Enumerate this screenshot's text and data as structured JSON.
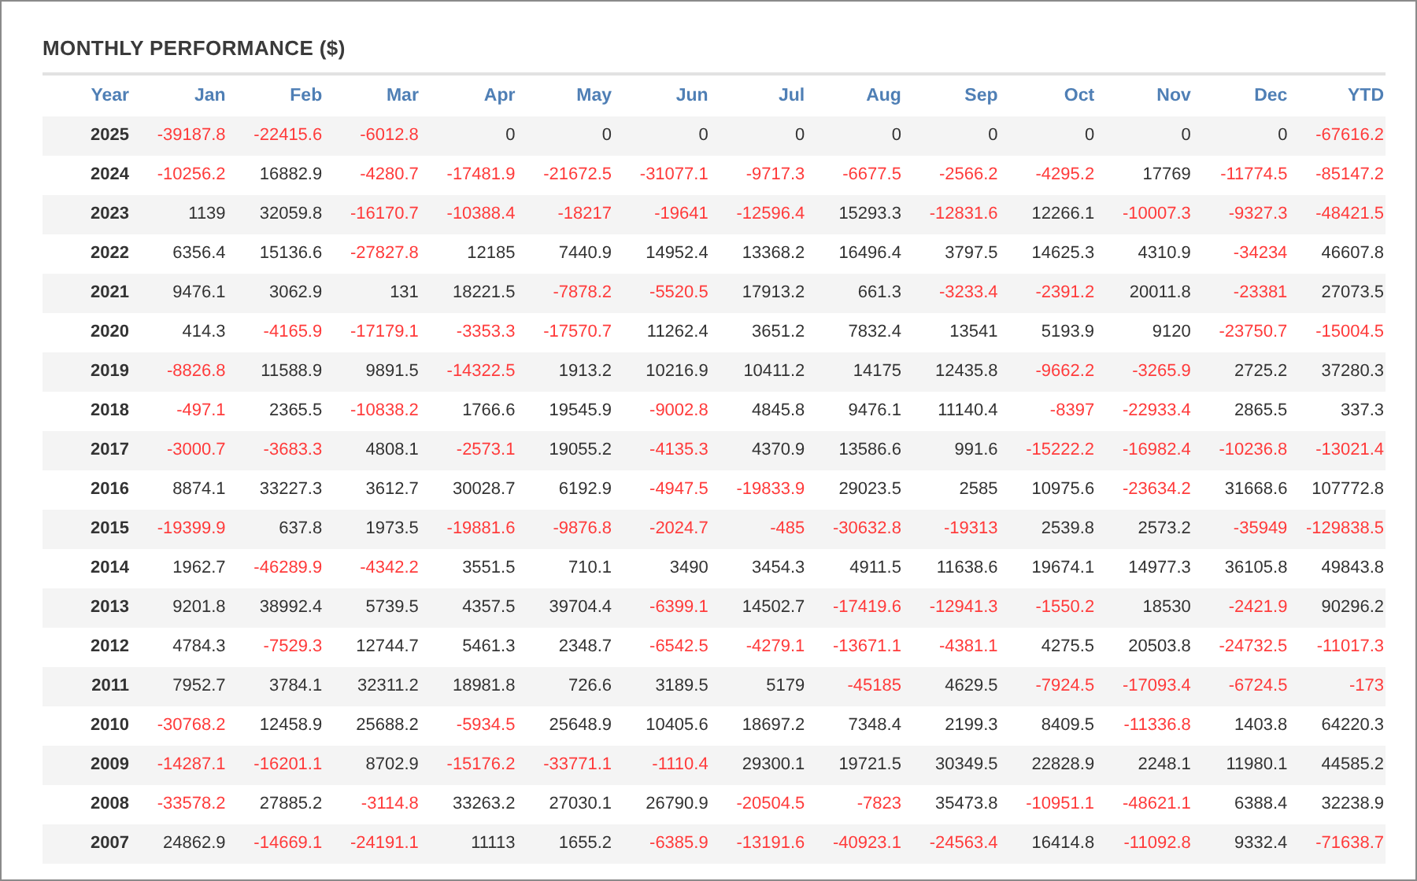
{
  "title": "MONTHLY PERFORMANCE ($)",
  "columns": [
    "Year",
    "Jan",
    "Feb",
    "Mar",
    "Apr",
    "May",
    "Jun",
    "Jul",
    "Aug",
    "Sep",
    "Oct",
    "Nov",
    "Dec",
    "YTD"
  ],
  "rows": [
    {
      "year": "2025",
      "cells": [
        {
          "text": "-39187.8",
          "negative": true
        },
        {
          "text": "-22415.6",
          "negative": true
        },
        {
          "text": "-6012.8",
          "negative": true
        },
        {
          "text": "0",
          "negative": false
        },
        {
          "text": "0",
          "negative": false
        },
        {
          "text": "0",
          "negative": false
        },
        {
          "text": "0",
          "negative": false
        },
        {
          "text": "0",
          "negative": false
        },
        {
          "text": "0",
          "negative": false
        },
        {
          "text": "0",
          "negative": false
        },
        {
          "text": "0",
          "negative": false
        },
        {
          "text": "0",
          "negative": false
        },
        {
          "text": "-67616.2",
          "negative": true
        }
      ]
    },
    {
      "year": "2024",
      "cells": [
        {
          "text": "-10256.2",
          "negative": true
        },
        {
          "text": "16882.9",
          "negative": false
        },
        {
          "text": "-4280.7",
          "negative": true
        },
        {
          "text": "-17481.9",
          "negative": true
        },
        {
          "text": "-21672.5",
          "negative": true
        },
        {
          "text": "-31077.1",
          "negative": true
        },
        {
          "text": "-9717.3",
          "negative": true
        },
        {
          "text": "-6677.5",
          "negative": true
        },
        {
          "text": "-2566.2",
          "negative": true
        },
        {
          "text": "-4295.2",
          "negative": true
        },
        {
          "text": "17769",
          "negative": false
        },
        {
          "text": "-11774.5",
          "negative": true
        },
        {
          "text": "-85147.2",
          "negative": true
        }
      ]
    },
    {
      "year": "2023",
      "cells": [
        {
          "text": "1139",
          "negative": false
        },
        {
          "text": "32059.8",
          "negative": false
        },
        {
          "text": "-16170.7",
          "negative": true
        },
        {
          "text": "-10388.4",
          "negative": true
        },
        {
          "text": "-18217",
          "negative": true
        },
        {
          "text": "-19641",
          "negative": true
        },
        {
          "text": "-12596.4",
          "negative": true
        },
        {
          "text": "15293.3",
          "negative": false
        },
        {
          "text": "-12831.6",
          "negative": true
        },
        {
          "text": "12266.1",
          "negative": false
        },
        {
          "text": "-10007.3",
          "negative": true
        },
        {
          "text": "-9327.3",
          "negative": true
        },
        {
          "text": "-48421.5",
          "negative": true
        }
      ]
    },
    {
      "year": "2022",
      "cells": [
        {
          "text": "6356.4",
          "negative": false
        },
        {
          "text": "15136.6",
          "negative": false
        },
        {
          "text": "-27827.8",
          "negative": true
        },
        {
          "text": "12185",
          "negative": false
        },
        {
          "text": "7440.9",
          "negative": false
        },
        {
          "text": "14952.4",
          "negative": false
        },
        {
          "text": "13368.2",
          "negative": false
        },
        {
          "text": "16496.4",
          "negative": false
        },
        {
          "text": "3797.5",
          "negative": false
        },
        {
          "text": "14625.3",
          "negative": false
        },
        {
          "text": "4310.9",
          "negative": false
        },
        {
          "text": "-34234",
          "negative": true
        },
        {
          "text": "46607.8",
          "negative": false
        }
      ]
    },
    {
      "year": "2021",
      "cells": [
        {
          "text": "9476.1",
          "negative": false
        },
        {
          "text": "3062.9",
          "negative": false
        },
        {
          "text": "131",
          "negative": false
        },
        {
          "text": "18221.5",
          "negative": false
        },
        {
          "text": "-7878.2",
          "negative": true
        },
        {
          "text": "-5520.5",
          "negative": true
        },
        {
          "text": "17913.2",
          "negative": false
        },
        {
          "text": "661.3",
          "negative": false
        },
        {
          "text": "-3233.4",
          "negative": true
        },
        {
          "text": "-2391.2",
          "negative": true
        },
        {
          "text": "20011.8",
          "negative": false
        },
        {
          "text": "-23381",
          "negative": true
        },
        {
          "text": "27073.5",
          "negative": false
        }
      ]
    },
    {
      "year": "2020",
      "cells": [
        {
          "text": "414.3",
          "negative": false
        },
        {
          "text": "-4165.9",
          "negative": true
        },
        {
          "text": "-17179.1",
          "negative": true
        },
        {
          "text": "-3353.3",
          "negative": true
        },
        {
          "text": "-17570.7",
          "negative": true
        },
        {
          "text": "11262.4",
          "negative": false
        },
        {
          "text": "3651.2",
          "negative": false
        },
        {
          "text": "7832.4",
          "negative": false
        },
        {
          "text": "13541",
          "negative": false
        },
        {
          "text": "5193.9",
          "negative": false
        },
        {
          "text": "9120",
          "negative": false
        },
        {
          "text": "-23750.7",
          "negative": true
        },
        {
          "text": "-15004.5",
          "negative": true
        }
      ]
    },
    {
      "year": "2019",
      "cells": [
        {
          "text": "-8826.8",
          "negative": true
        },
        {
          "text": "11588.9",
          "negative": false
        },
        {
          "text": "9891.5",
          "negative": false
        },
        {
          "text": "-14322.5",
          "negative": true
        },
        {
          "text": "1913.2",
          "negative": false
        },
        {
          "text": "10216.9",
          "negative": false
        },
        {
          "text": "10411.2",
          "negative": false
        },
        {
          "text": "14175",
          "negative": false
        },
        {
          "text": "12435.8",
          "negative": false
        },
        {
          "text": "-9662.2",
          "negative": true
        },
        {
          "text": "-3265.9",
          "negative": true
        },
        {
          "text": "2725.2",
          "negative": false
        },
        {
          "text": "37280.3",
          "negative": false
        }
      ]
    },
    {
      "year": "2018",
      "cells": [
        {
          "text": "-497.1",
          "negative": true
        },
        {
          "text": "2365.5",
          "negative": false
        },
        {
          "text": "-10838.2",
          "negative": true
        },
        {
          "text": "1766.6",
          "negative": false
        },
        {
          "text": "19545.9",
          "negative": false
        },
        {
          "text": "-9002.8",
          "negative": true
        },
        {
          "text": "4845.8",
          "negative": false
        },
        {
          "text": "9476.1",
          "negative": false
        },
        {
          "text": "11140.4",
          "negative": false
        },
        {
          "text": "-8397",
          "negative": true
        },
        {
          "text": "-22933.4",
          "negative": true
        },
        {
          "text": "2865.5",
          "negative": false
        },
        {
          "text": "337.3",
          "negative": false
        }
      ]
    },
    {
      "year": "2017",
      "cells": [
        {
          "text": "-3000.7",
          "negative": true
        },
        {
          "text": "-3683.3",
          "negative": true
        },
        {
          "text": "4808.1",
          "negative": false
        },
        {
          "text": "-2573.1",
          "negative": true
        },
        {
          "text": "19055.2",
          "negative": false
        },
        {
          "text": "-4135.3",
          "negative": true
        },
        {
          "text": "4370.9",
          "negative": false
        },
        {
          "text": "13586.6",
          "negative": false
        },
        {
          "text": "991.6",
          "negative": false
        },
        {
          "text": "-15222.2",
          "negative": true
        },
        {
          "text": "-16982.4",
          "negative": true
        },
        {
          "text": "-10236.8",
          "negative": true
        },
        {
          "text": "-13021.4",
          "negative": true
        }
      ]
    },
    {
      "year": "2016",
      "cells": [
        {
          "text": "8874.1",
          "negative": false
        },
        {
          "text": "33227.3",
          "negative": false
        },
        {
          "text": "3612.7",
          "negative": false
        },
        {
          "text": "30028.7",
          "negative": false
        },
        {
          "text": "6192.9",
          "negative": false
        },
        {
          "text": "-4947.5",
          "negative": true
        },
        {
          "text": "-19833.9",
          "negative": true
        },
        {
          "text": "29023.5",
          "negative": false
        },
        {
          "text": "2585",
          "negative": false
        },
        {
          "text": "10975.6",
          "negative": false
        },
        {
          "text": "-23634.2",
          "negative": true
        },
        {
          "text": "31668.6",
          "negative": false
        },
        {
          "text": "107772.8",
          "negative": false
        }
      ]
    },
    {
      "year": "2015",
      "cells": [
        {
          "text": "-19399.9",
          "negative": true
        },
        {
          "text": "637.8",
          "negative": false
        },
        {
          "text": "1973.5",
          "negative": false
        },
        {
          "text": "-19881.6",
          "negative": true
        },
        {
          "text": "-9876.8",
          "negative": true
        },
        {
          "text": "-2024.7",
          "negative": true
        },
        {
          "text": "-485",
          "negative": true
        },
        {
          "text": "-30632.8",
          "negative": true
        },
        {
          "text": "-19313",
          "negative": true
        },
        {
          "text": "2539.8",
          "negative": false
        },
        {
          "text": "2573.2",
          "negative": false
        },
        {
          "text": "-35949",
          "negative": true
        },
        {
          "text": "-129838.5",
          "negative": true
        }
      ]
    },
    {
      "year": "2014",
      "cells": [
        {
          "text": "1962.7",
          "negative": false
        },
        {
          "text": "-46289.9",
          "negative": true
        },
        {
          "text": "-4342.2",
          "negative": true
        },
        {
          "text": "3551.5",
          "negative": false
        },
        {
          "text": "710.1",
          "negative": false
        },
        {
          "text": "3490",
          "negative": false
        },
        {
          "text": "3454.3",
          "negative": false
        },
        {
          "text": "4911.5",
          "negative": false
        },
        {
          "text": "11638.6",
          "negative": false
        },
        {
          "text": "19674.1",
          "negative": false
        },
        {
          "text": "14977.3",
          "negative": false
        },
        {
          "text": "36105.8",
          "negative": false
        },
        {
          "text": "49843.8",
          "negative": false
        }
      ]
    },
    {
      "year": "2013",
      "cells": [
        {
          "text": "9201.8",
          "negative": false
        },
        {
          "text": "38992.4",
          "negative": false
        },
        {
          "text": "5739.5",
          "negative": false
        },
        {
          "text": "4357.5",
          "negative": false
        },
        {
          "text": "39704.4",
          "negative": false
        },
        {
          "text": "-6399.1",
          "negative": true
        },
        {
          "text": "14502.7",
          "negative": false
        },
        {
          "text": "-17419.6",
          "negative": true
        },
        {
          "text": "-12941.3",
          "negative": true
        },
        {
          "text": "-1550.2",
          "negative": true
        },
        {
          "text": "18530",
          "negative": false
        },
        {
          "text": "-2421.9",
          "negative": true
        },
        {
          "text": "90296.2",
          "negative": false
        }
      ]
    },
    {
      "year": "2012",
      "cells": [
        {
          "text": "4784.3",
          "negative": false
        },
        {
          "text": "-7529.3",
          "negative": true
        },
        {
          "text": "12744.7",
          "negative": false
        },
        {
          "text": "5461.3",
          "negative": false
        },
        {
          "text": "2348.7",
          "negative": false
        },
        {
          "text": "-6542.5",
          "negative": true
        },
        {
          "text": "-4279.1",
          "negative": true
        },
        {
          "text": "-13671.1",
          "negative": true
        },
        {
          "text": "-4381.1",
          "negative": true
        },
        {
          "text": "4275.5",
          "negative": false
        },
        {
          "text": "20503.8",
          "negative": false
        },
        {
          "text": "-24732.5",
          "negative": true
        },
        {
          "text": "-11017.3",
          "negative": true
        }
      ]
    },
    {
      "year": "2011",
      "cells": [
        {
          "text": "7952.7",
          "negative": false
        },
        {
          "text": "3784.1",
          "negative": false
        },
        {
          "text": "32311.2",
          "negative": false
        },
        {
          "text": "18981.8",
          "negative": false
        },
        {
          "text": "726.6",
          "negative": false
        },
        {
          "text": "3189.5",
          "negative": false
        },
        {
          "text": "5179",
          "negative": false
        },
        {
          "text": "-45185",
          "negative": true
        },
        {
          "text": "4629.5",
          "negative": false
        },
        {
          "text": "-7924.5",
          "negative": true
        },
        {
          "text": "-17093.4",
          "negative": true
        },
        {
          "text": "-6724.5",
          "negative": true
        },
        {
          "text": "-173",
          "negative": true
        }
      ]
    },
    {
      "year": "2010",
      "cells": [
        {
          "text": "-30768.2",
          "negative": true
        },
        {
          "text": "12458.9",
          "negative": false
        },
        {
          "text": "25688.2",
          "negative": false
        },
        {
          "text": "-5934.5",
          "negative": true
        },
        {
          "text": "25648.9",
          "negative": false
        },
        {
          "text": "10405.6",
          "negative": false
        },
        {
          "text": "18697.2",
          "negative": false
        },
        {
          "text": "7348.4",
          "negative": false
        },
        {
          "text": "2199.3",
          "negative": false
        },
        {
          "text": "8409.5",
          "negative": false
        },
        {
          "text": "-11336.8",
          "negative": true
        },
        {
          "text": "1403.8",
          "negative": false
        },
        {
          "text": "64220.3",
          "negative": false
        }
      ]
    },
    {
      "year": "2009",
      "cells": [
        {
          "text": "-14287.1",
          "negative": true
        },
        {
          "text": "-16201.1",
          "negative": true
        },
        {
          "text": "8702.9",
          "negative": false
        },
        {
          "text": "-15176.2",
          "negative": true
        },
        {
          "text": "-33771.1",
          "negative": true
        },
        {
          "text": "-1110.4",
          "negative": true
        },
        {
          "text": "29300.1",
          "negative": false
        },
        {
          "text": "19721.5",
          "negative": false
        },
        {
          "text": "30349.5",
          "negative": false
        },
        {
          "text": "22828.9",
          "negative": false
        },
        {
          "text": "2248.1",
          "negative": false
        },
        {
          "text": "11980.1",
          "negative": false
        },
        {
          "text": "44585.2",
          "negative": false
        }
      ]
    },
    {
      "year": "2008",
      "cells": [
        {
          "text": "-33578.2",
          "negative": true
        },
        {
          "text": "27885.2",
          "negative": false
        },
        {
          "text": "-3114.8",
          "negative": true
        },
        {
          "text": "33263.2",
          "negative": false
        },
        {
          "text": "27030.1",
          "negative": false
        },
        {
          "text": "26790.9",
          "negative": false
        },
        {
          "text": "-20504.5",
          "negative": true
        },
        {
          "text": "-7823",
          "negative": true
        },
        {
          "text": "35473.8",
          "negative": false
        },
        {
          "text": "-10951.1",
          "negative": true
        },
        {
          "text": "-48621.1",
          "negative": true
        },
        {
          "text": "6388.4",
          "negative": false
        },
        {
          "text": "32238.9",
          "negative": false
        }
      ]
    },
    {
      "year": "2007",
      "cells": [
        {
          "text": "24862.9",
          "negative": false
        },
        {
          "text": "-14669.1",
          "negative": true
        },
        {
          "text": "-24191.1",
          "negative": true
        },
        {
          "text": "11113",
          "negative": false
        },
        {
          "text": "1655.2",
          "negative": false
        },
        {
          "text": "-6385.9",
          "negative": true
        },
        {
          "text": "-13191.6",
          "negative": true
        },
        {
          "text": "-40923.1",
          "negative": true
        },
        {
          "text": "-24563.4",
          "negative": true
        },
        {
          "text": "16414.8",
          "negative": false
        },
        {
          "text": "-11092.8",
          "negative": true
        },
        {
          "text": "9332.4",
          "negative": false
        },
        {
          "text": "-71638.7",
          "negative": true
        }
      ]
    }
  ]
}
